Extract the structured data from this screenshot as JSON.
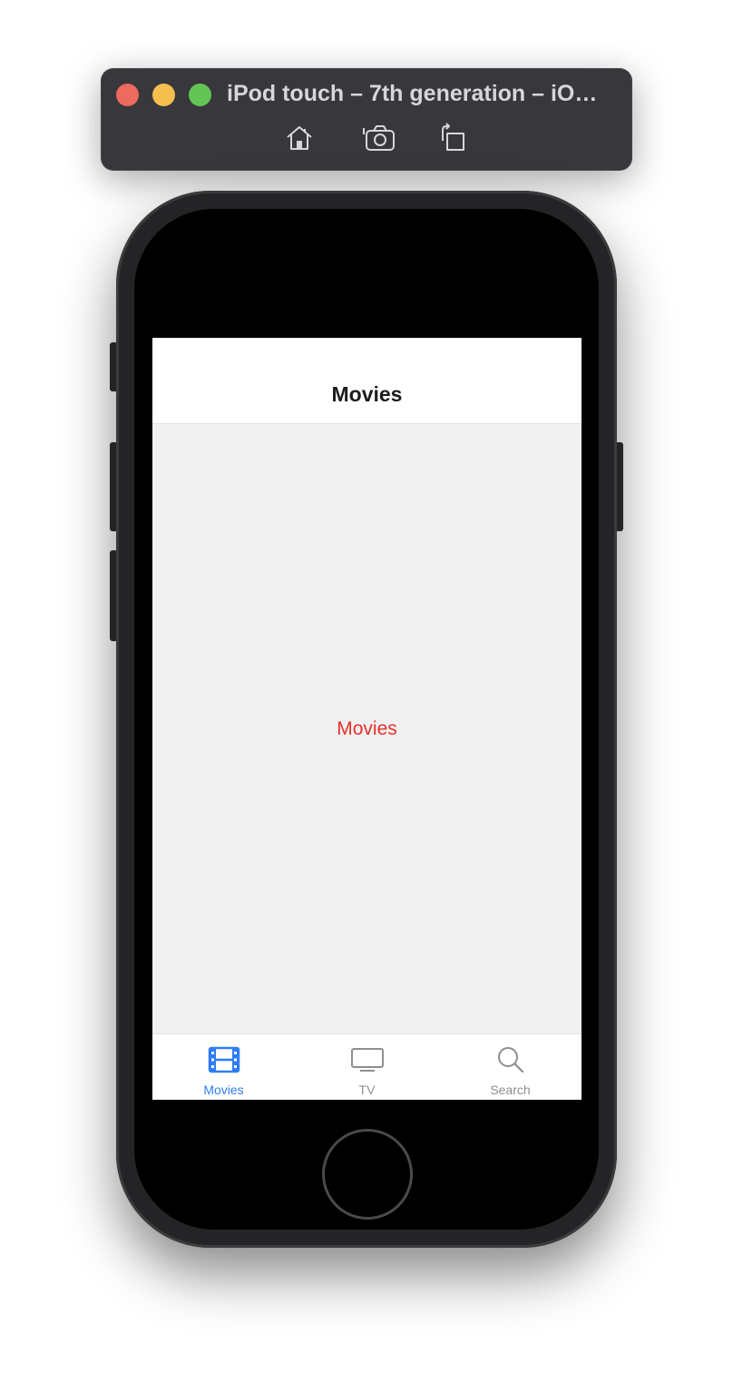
{
  "simulator": {
    "window_title": "iPod touch – 7th generation – iO…",
    "toolbar": {
      "home_icon": "home-icon",
      "screenshot_icon": "camera-icon",
      "rotate_icon": "rotate-icon"
    },
    "traffic_lights": {
      "close_color": "#ed6a5e",
      "minimize_color": "#f5bf4f",
      "zoom_color": "#62c554"
    }
  },
  "app": {
    "nav_title": "Movies",
    "content_text": "Movies",
    "content_text_color": "#e5322d",
    "tabs": [
      {
        "label": "Movies",
        "icon": "film-icon",
        "selected": true
      },
      {
        "label": "TV",
        "icon": "tv-icon",
        "selected": false
      },
      {
        "label": "Search",
        "icon": "search-icon",
        "selected": false
      }
    ],
    "colors": {
      "tab_selected": "#2f7cf6",
      "tab_unselected": "#8e8e93",
      "background": "#f1f1f1"
    }
  }
}
